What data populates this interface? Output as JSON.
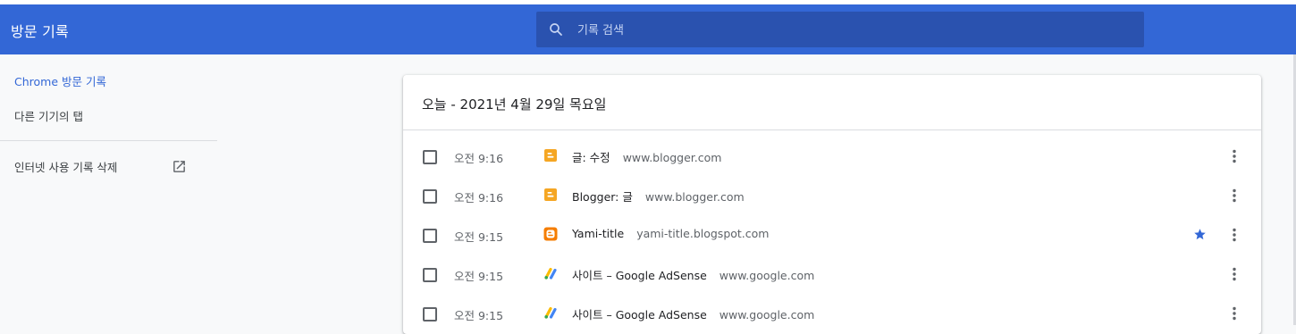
{
  "header": {
    "title": "방문 기록",
    "search_placeholder": "기록 검색"
  },
  "sidebar": {
    "items": [
      {
        "label": "Chrome 방문 기록",
        "active": true
      },
      {
        "label": "다른 기기의 탭"
      },
      {
        "label": "인터넷 사용 기록 삭제",
        "icon": "open-in-new-icon"
      }
    ]
  },
  "main": {
    "date_heading": "오늘 - 2021년 4월 29일 목요일",
    "rows": [
      {
        "time": "오전 9:16",
        "title": "글: 수정",
        "domain": "www.blogger.com",
        "favicon": "blogger-icon",
        "starred": false
      },
      {
        "time": "오전 9:16",
        "title": "Blogger: 글",
        "domain": "www.blogger.com",
        "favicon": "blogger-icon",
        "starred": false
      },
      {
        "time": "오전 9:15",
        "title": "Yami-title",
        "domain": "yami-title.blogspot.com",
        "favicon": "blogspot-icon",
        "starred": true
      },
      {
        "time": "오전 9:15",
        "title": "사이트 – Google AdSense",
        "domain": "www.google.com",
        "favicon": "adsense-icon",
        "starred": false
      },
      {
        "time": "오전 9:15",
        "title": "사이트 – Google AdSense",
        "domain": "www.google.com",
        "favicon": "adsense-icon",
        "starred": false
      }
    ]
  },
  "colors": {
    "toolbar": "#3367d6",
    "search_bg": "#2a52af",
    "accent": "#3367d6",
    "blogger_orange": "#f5a623",
    "blogspot_orange": "#f57d00"
  }
}
